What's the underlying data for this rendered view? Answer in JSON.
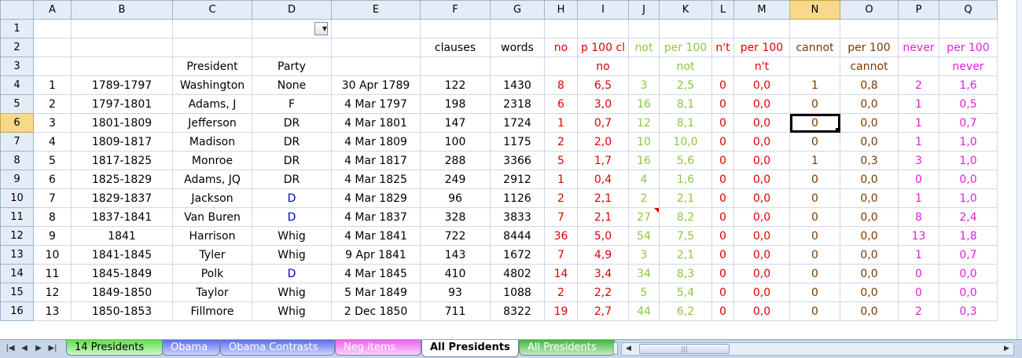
{
  "colors": {
    "red": "#e00000",
    "green": "#8dc640",
    "magenta": "#e020e0",
    "blue": "#0000d0",
    "brown": "#7a3a00",
    "black": "#000000"
  },
  "column_headers": [
    "A",
    "B",
    "C",
    "D",
    "E",
    "F",
    "G",
    "H",
    "I",
    "J",
    "K",
    "L",
    "M",
    "N",
    "O",
    "P",
    "Q"
  ],
  "selected_column": "N",
  "selected_row": 6,
  "active_cell": "N6",
  "filter_button_icon": "dropdown-arrow-icon",
  "comment_indicator_cell": "J11",
  "header_rows": [
    {
      "row": 1,
      "cells": [
        "",
        "",
        "",
        "",
        "",
        "",
        "",
        "",
        "",
        "",
        "",
        "",
        "",
        "",
        "",
        "",
        ""
      ]
    },
    {
      "row": 2,
      "cells": [
        "",
        "",
        "",
        "",
        "",
        "clauses",
        "words",
        "no",
        "p 100 cl",
        "not",
        "per 100",
        "n't",
        "per 100",
        "cannot",
        "per 100",
        "never",
        "per 100"
      ]
    },
    {
      "row": 3,
      "cells": [
        "",
        "",
        "President",
        "Party",
        "",
        "",
        "",
        "",
        "no",
        "",
        "not",
        "",
        "n't",
        "",
        "cannot",
        "",
        "never"
      ]
    }
  ],
  "data_rows": [
    {
      "row": 4,
      "cells": [
        "1",
        "1789-1797",
        "Washington",
        "None",
        "30 Apr 1789",
        "122",
        "1430",
        "8",
        "6,5",
        "3",
        "2,5",
        "0",
        "0,0",
        "1",
        "0,8",
        "2",
        "1,6"
      ]
    },
    {
      "row": 5,
      "cells": [
        "2",
        "1797-1801",
        "Adams, J",
        "F",
        "4 Mar 1797",
        "198",
        "2318",
        "6",
        "3,0",
        "16",
        "8,1",
        "0",
        "0,0",
        "0",
        "0,0",
        "1",
        "0,5"
      ]
    },
    {
      "row": 6,
      "cells": [
        "3",
        "1801-1809",
        "Jefferson",
        "DR",
        "4 Mar 1801",
        "147",
        "1724",
        "1",
        "0,7",
        "12",
        "8,1",
        "0",
        "0,0",
        "0",
        "0,0",
        "1",
        "0,7"
      ]
    },
    {
      "row": 7,
      "cells": [
        "4",
        "1809-1817",
        "Madison",
        "DR",
        "4 Mar 1809",
        "100",
        "1175",
        "2",
        "2,0",
        "10",
        "10,0",
        "0",
        "0,0",
        "0",
        "0,0",
        "1",
        "1,0"
      ]
    },
    {
      "row": 8,
      "cells": [
        "5",
        "1817-1825",
        "Monroe",
        "DR",
        "4 Mar 1817",
        "288",
        "3366",
        "5",
        "1,7",
        "16",
        "5,6",
        "0",
        "0,0",
        "1",
        "0,3",
        "3",
        "1,0"
      ]
    },
    {
      "row": 9,
      "cells": [
        "6",
        "1825-1829",
        "Adams, JQ",
        "DR",
        "4 Mar 1825",
        "249",
        "2912",
        "1",
        "0,4",
        "4",
        "1,6",
        "0",
        "0,0",
        "0",
        "0,0",
        "0",
        "0,0"
      ]
    },
    {
      "row": 10,
      "cells": [
        "7",
        "1829-1837",
        "Jackson",
        "D",
        "4 Mar 1829",
        "96",
        "1126",
        "2",
        "2,1",
        "2",
        "2,1",
        "0",
        "0,0",
        "0",
        "0,0",
        "1",
        "1,0"
      ]
    },
    {
      "row": 11,
      "cells": [
        "8",
        "1837-1841",
        "Van Buren",
        "D",
        "4 Mar 1837",
        "328",
        "3833",
        "7",
        "2,1",
        "27",
        "8,2",
        "0",
        "0,0",
        "0",
        "0,0",
        "8",
        "2,4"
      ]
    },
    {
      "row": 12,
      "cells": [
        "9",
        "1841",
        "Harrison",
        "Whig",
        "4 Mar 1841",
        "722",
        "8444",
        "36",
        "5,0",
        "54",
        "7,5",
        "0",
        "0,0",
        "0",
        "0,0",
        "13",
        "1,8"
      ]
    },
    {
      "row": 13,
      "cells": [
        "10",
        "1841-1845",
        "Tyler",
        "Whig",
        "9 Apr 1841",
        "143",
        "1672",
        "7",
        "4,9",
        "3",
        "2,1",
        "0",
        "0,0",
        "0",
        "0,0",
        "1",
        "0,7"
      ]
    },
    {
      "row": 14,
      "cells": [
        "11",
        "1845-1849",
        "Polk",
        "D",
        "4 Mar 1845",
        "410",
        "4802",
        "14",
        "3,4",
        "34",
        "8,3",
        "0",
        "0,0",
        "0",
        "0,0",
        "0",
        "0,0"
      ]
    },
    {
      "row": 15,
      "cells": [
        "12",
        "1849-1850",
        "Taylor",
        "Whig",
        "5 Mar 1849",
        "93",
        "1088",
        "2",
        "2,2",
        "5",
        "5,4",
        "0",
        "0,0",
        "0",
        "0,0",
        "0",
        "0,0"
      ]
    },
    {
      "row": 16,
      "cells": [
        "13",
        "1850-1853",
        "Fillmore",
        "Whig",
        "2 Dec 1850",
        "711",
        "8322",
        "19",
        "2,7",
        "44",
        "6,2",
        "0",
        "0,0",
        "0",
        "0,0",
        "2",
        "0,3"
      ]
    }
  ],
  "sheet_tabs": [
    {
      "label": "14 Presidents",
      "color": "#5ee04a",
      "active": false
    },
    {
      "label": "Obama",
      "color": "#5a6cf0",
      "active": false
    },
    {
      "label": "Obama Contrasts",
      "color": "#5a6cf0",
      "active": false
    },
    {
      "label": "Neg items",
      "color": "#f060f0",
      "active": false
    },
    {
      "label": "All Presidents",
      "color": "#ffffff",
      "active": true
    },
    {
      "label": "All Presidents",
      "color": "#3fb83f",
      "active": false
    }
  ],
  "tab_nav": {
    "first": "|◀",
    "prev": "◀",
    "next": "▶",
    "last": "▶|"
  },
  "scroll": {
    "left": "◀",
    "right": "▶",
    "thumb_grip": "|||"
  }
}
